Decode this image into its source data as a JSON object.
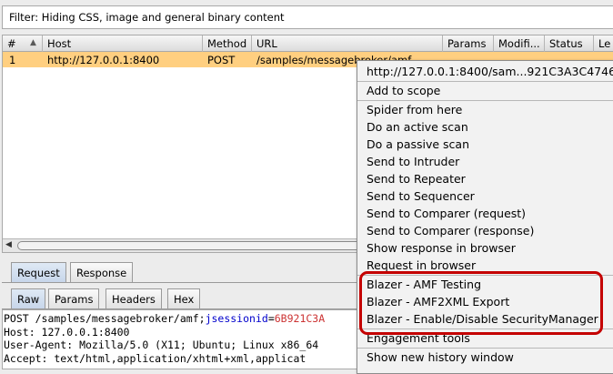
{
  "filter": {
    "text": "Filter: Hiding CSS, image and general binary content"
  },
  "table": {
    "columns": [
      "#",
      "Host",
      "Method",
      "URL",
      "Params",
      "Modifi...",
      "Status",
      "Le"
    ],
    "rows": [
      {
        "num": "1",
        "host": "http://127.0.0.1:8400",
        "method": "POST",
        "url": "/samples/messagebroker/amf"
      }
    ]
  },
  "request_tabs": [
    "Request",
    "Response"
  ],
  "view_tabs": [
    "Raw",
    "Params",
    "Headers",
    "Hex"
  ],
  "raw": {
    "line1_prefix": "POST /samples/messagebroker/amf;",
    "line1_key": "jsessionid",
    "line1_eq": "=",
    "line1_value": "6B921C3A",
    "line2": "Host: 127.0.0.1:8400",
    "line3": "User-Agent: Mozilla/5.0 (X11; Ubuntu; Linux x86_64",
    "line4": "Accept: text/html,application/xhtml+xml,applicat"
  },
  "menu": {
    "header": "http://127.0.0.1:8400/sam...921C3A3C4746",
    "items": [
      "Add to scope",
      "Spider from here",
      "Do an active scan",
      "Do a passive scan",
      "Send to Intruder",
      "Send to Repeater",
      "Send to Sequencer",
      "Send to Comparer (request)",
      "Send to Comparer (response)",
      "Show response in browser",
      "Request in browser",
      "Blazer - AMF Testing",
      "Blazer - AMF2XML Export",
      "Blazer - Enable/Disable SecurityManager",
      "Engagement tools",
      "Show new history window"
    ]
  },
  "colors": {
    "selected_row": "#ffcf80",
    "highlight": "#c40000"
  }
}
